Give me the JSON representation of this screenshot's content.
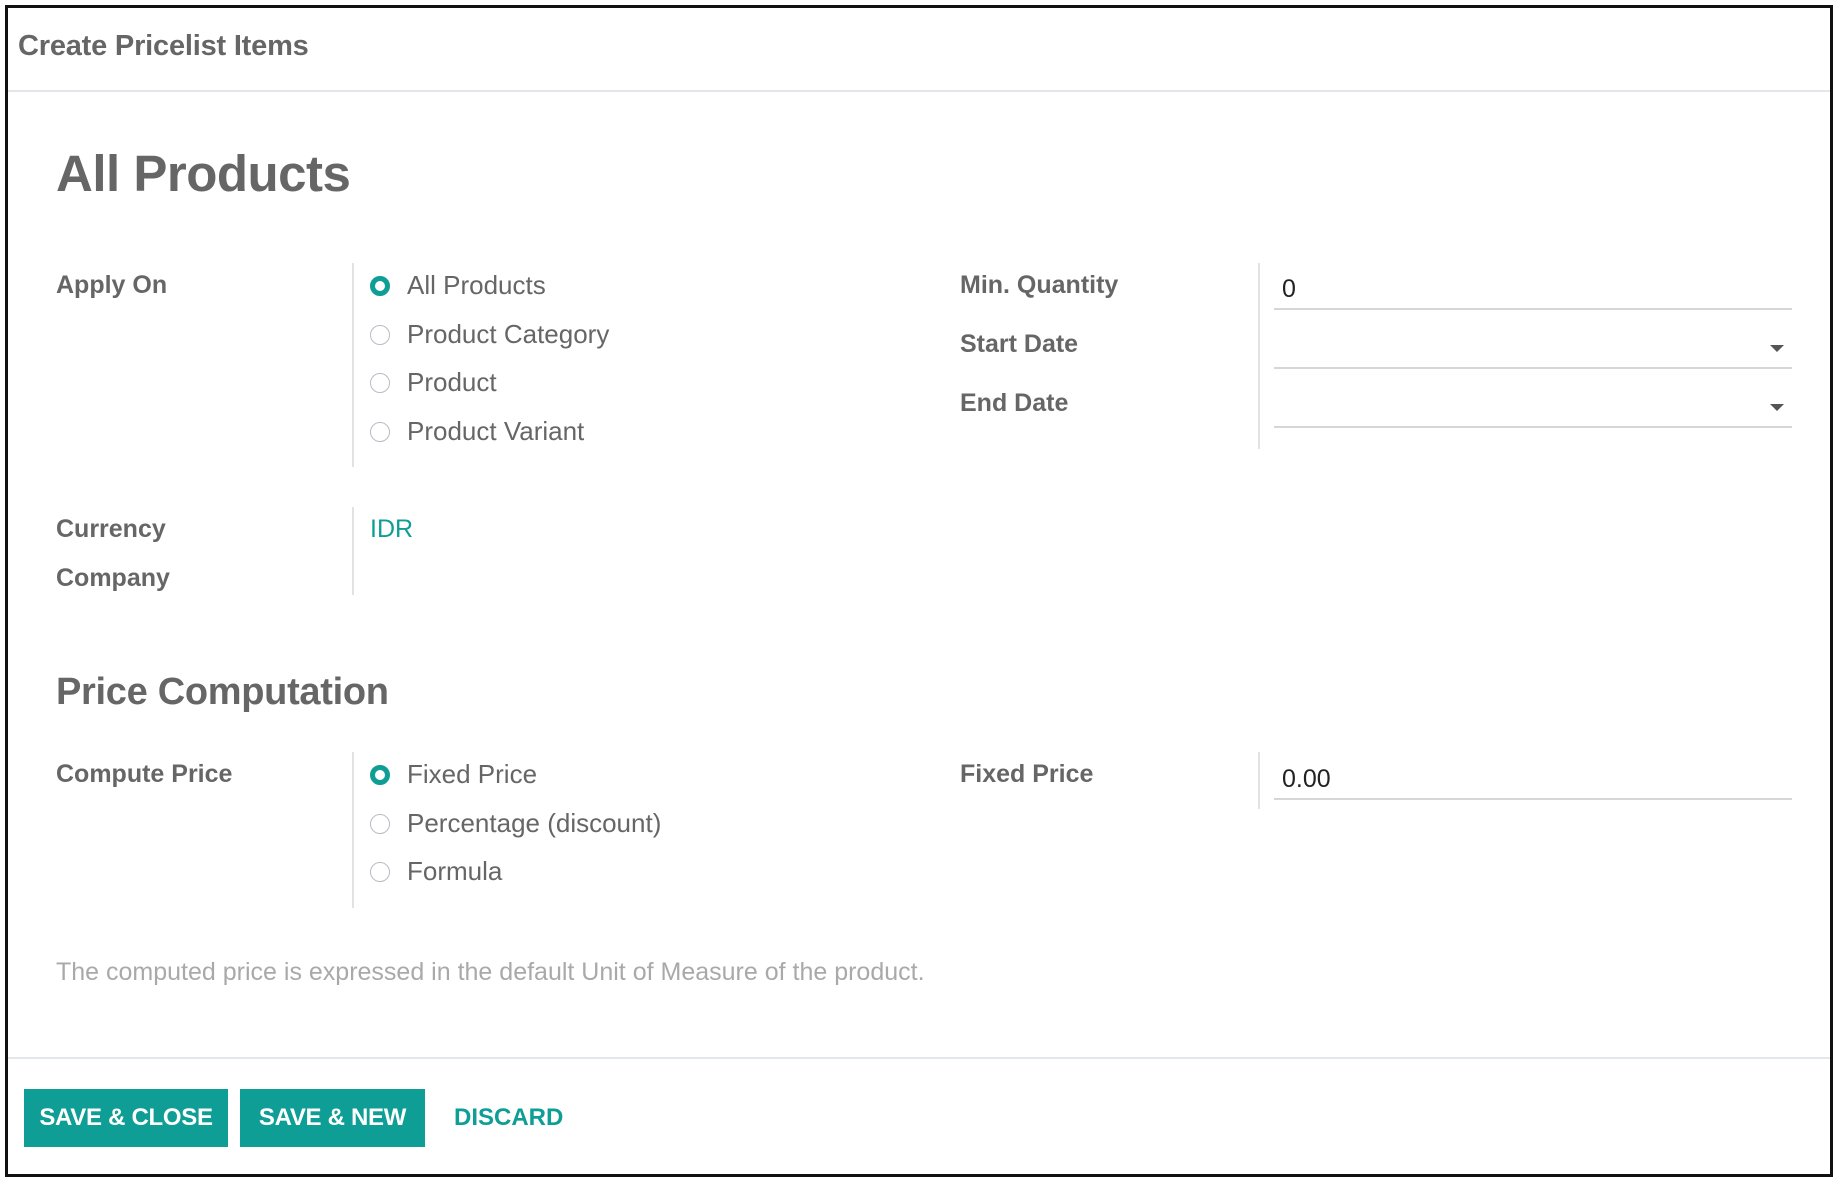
{
  "dialog": {
    "title": "Create Pricelist Items"
  },
  "record": {
    "title": "All Products"
  },
  "apply_on": {
    "label": "Apply On",
    "options": [
      {
        "label": "All Products",
        "checked": true
      },
      {
        "label": "Product Category",
        "checked": false
      },
      {
        "label": "Product",
        "checked": false
      },
      {
        "label": "Product Variant",
        "checked": false
      }
    ]
  },
  "min_quantity": {
    "label": "Min. Quantity",
    "value": "0"
  },
  "start_date": {
    "label": "Start Date",
    "value": "",
    "icon": "caret-down-icon"
  },
  "end_date": {
    "label": "End Date",
    "value": "",
    "icon": "caret-down-icon"
  },
  "currency": {
    "label": "Currency",
    "value": "IDR"
  },
  "company": {
    "label": "Company",
    "value": ""
  },
  "price_computation": {
    "section_title": "Price Computation",
    "compute_price": {
      "label": "Compute Price",
      "options": [
        {
          "label": "Fixed Price",
          "checked": true
        },
        {
          "label": "Percentage (discount)",
          "checked": false
        },
        {
          "label": "Formula",
          "checked": false
        }
      ]
    },
    "fixed_price": {
      "label": "Fixed Price",
      "value": "0.00"
    },
    "help_note": "The computed price is expressed in the default Unit of Measure of the product."
  },
  "footer": {
    "save_close_label": "SAVE & CLOSE",
    "save_new_label": "SAVE & NEW",
    "discard_label": "DISCARD"
  },
  "colors": {
    "accent": "#0e9e96",
    "label_text": "#666666",
    "help_text": "#a9a9a9"
  }
}
